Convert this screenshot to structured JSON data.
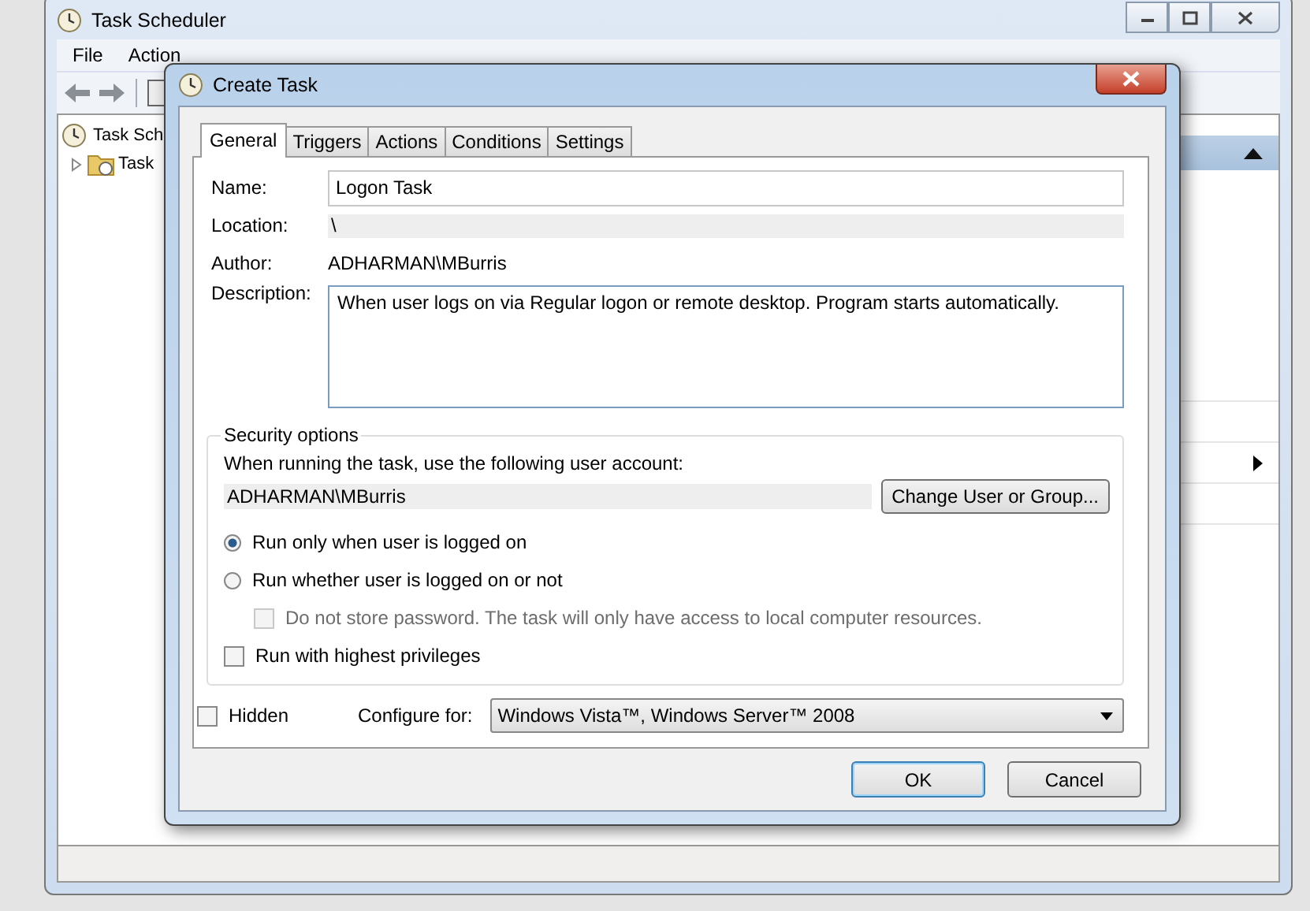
{
  "main_window": {
    "title": "Task Scheduler",
    "menu": [
      "File",
      "Action"
    ],
    "tree": [
      {
        "label": "Task Sch",
        "children": [
          {
            "label": "Task",
            "expanded": false
          }
        ]
      }
    ]
  },
  "dialog": {
    "title": "Create Task",
    "tabs": [
      {
        "label": "General",
        "selected": true
      },
      {
        "label": "Triggers",
        "selected": false
      },
      {
        "label": "Actions",
        "selected": false
      },
      {
        "label": "Conditions",
        "selected": false
      },
      {
        "label": "Settings",
        "selected": false
      }
    ],
    "name": {
      "label": "Name:",
      "value": "Logon Task"
    },
    "location": {
      "label": "Location:",
      "value": "\\"
    },
    "author": {
      "label": "Author:",
      "value": "ADHARMAN\\MBurris"
    },
    "description": {
      "label": "Description:",
      "value": "When user logs on via Regular logon or remote desktop. Program starts automatically."
    },
    "security": {
      "title": "Security options",
      "account_label": "When running the task, use the following user account:",
      "account": "ADHARMAN\\MBurris",
      "change_button": "Change User or Group...",
      "options": [
        {
          "kind": "radio",
          "label": "Run only when user is logged on",
          "selected": true,
          "disabled": false
        },
        {
          "kind": "radio",
          "label": "Run whether user is logged on or not",
          "selected": false,
          "disabled": false,
          "children": [
            {
              "kind": "checkbox",
              "label": "Do not store password.  The task will only have access to local computer resources.",
              "checked": false,
              "disabled": true
            }
          ]
        },
        {
          "kind": "checkbox",
          "label": "Run with highest privileges",
          "checked": false,
          "disabled": false
        }
      ]
    },
    "hidden": {
      "label": "Hidden",
      "checked": false
    },
    "configure": {
      "label": "Configure for:",
      "value": "Windows Vista™, Windows Server™ 2008"
    },
    "buttons": [
      {
        "label": "OK",
        "default": true
      },
      {
        "label": "Cancel",
        "default": false
      }
    ]
  }
}
